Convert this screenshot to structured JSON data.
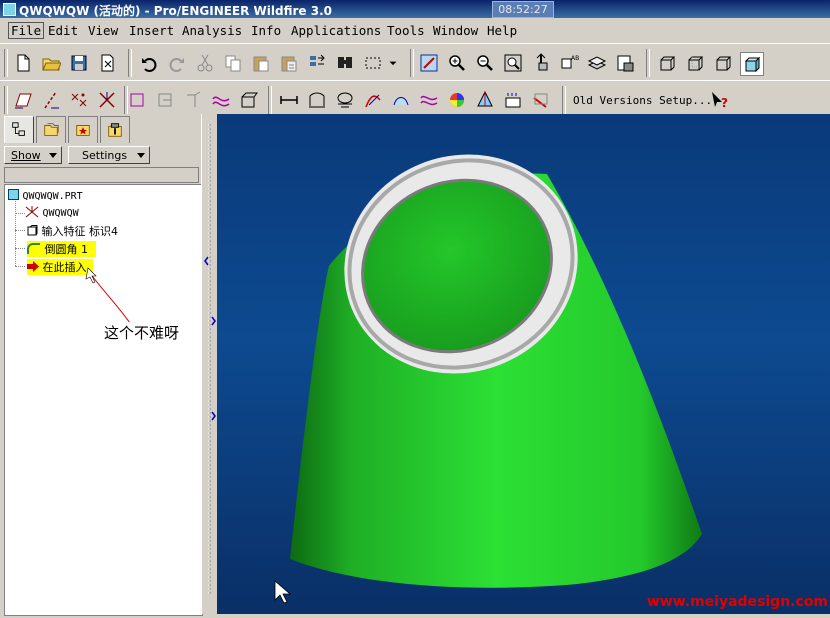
{
  "window": {
    "title": "QWQWQW (活动的) - Pro/ENGINEER Wildfire 3.0",
    "clock": "08:52:27"
  },
  "menu": {
    "items": [
      "File",
      "Edit",
      "View",
      "Insert",
      "Analysis",
      "Info",
      "Applications",
      "Tools",
      "Window",
      "Help"
    ]
  },
  "toolbar": {
    "old_versions_label": "Old Versions Setup..."
  },
  "panel": {
    "show_label": "Show",
    "settings_label": "Settings"
  },
  "tree": {
    "root": "QWQWQW.PRT",
    "items": [
      "QWQWQW",
      "输入特征 标识4",
      "倒圆角 1",
      "在此插入"
    ]
  },
  "annotation": {
    "text": "这个不难呀"
  },
  "watermark": "www.meiyadesign.com",
  "colors": {
    "model_green": "#22c42a",
    "viewport_blue": "#0d4a90",
    "highlight": "#ffff00",
    "watermark_red": "#e00000"
  }
}
